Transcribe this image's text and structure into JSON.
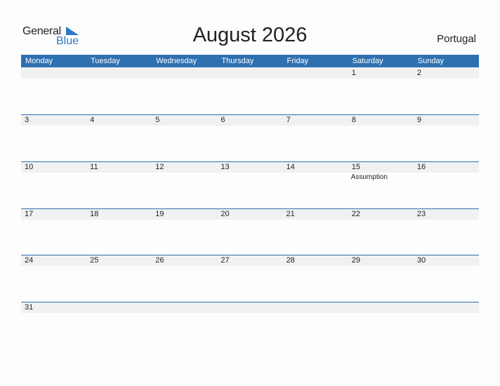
{
  "logo": {
    "word1": "General",
    "word2": "Blue"
  },
  "title": "August 2026",
  "country": "Portugal",
  "colors": {
    "accent": "#2e70b0",
    "date_strip": "#f1f1f1"
  },
  "weekdays": [
    "Monday",
    "Tuesday",
    "Wednesday",
    "Thursday",
    "Friday",
    "Saturday",
    "Sunday"
  ],
  "weeks": [
    [
      {
        "date": ""
      },
      {
        "date": ""
      },
      {
        "date": ""
      },
      {
        "date": ""
      },
      {
        "date": ""
      },
      {
        "date": "1"
      },
      {
        "date": "2"
      }
    ],
    [
      {
        "date": "3"
      },
      {
        "date": "4"
      },
      {
        "date": "5"
      },
      {
        "date": "6"
      },
      {
        "date": "7"
      },
      {
        "date": "8"
      },
      {
        "date": "9"
      }
    ],
    [
      {
        "date": "10"
      },
      {
        "date": "11"
      },
      {
        "date": "12"
      },
      {
        "date": "13"
      },
      {
        "date": "14"
      },
      {
        "date": "15",
        "event": "Assumption"
      },
      {
        "date": "16"
      }
    ],
    [
      {
        "date": "17"
      },
      {
        "date": "18"
      },
      {
        "date": "19"
      },
      {
        "date": "20"
      },
      {
        "date": "21"
      },
      {
        "date": "22"
      },
      {
        "date": "23"
      }
    ],
    [
      {
        "date": "24"
      },
      {
        "date": "25"
      },
      {
        "date": "26"
      },
      {
        "date": "27"
      },
      {
        "date": "28"
      },
      {
        "date": "29"
      },
      {
        "date": "30"
      }
    ],
    [
      {
        "date": "31"
      },
      {
        "date": ""
      },
      {
        "date": ""
      },
      {
        "date": ""
      },
      {
        "date": ""
      },
      {
        "date": ""
      },
      {
        "date": ""
      }
    ]
  ]
}
